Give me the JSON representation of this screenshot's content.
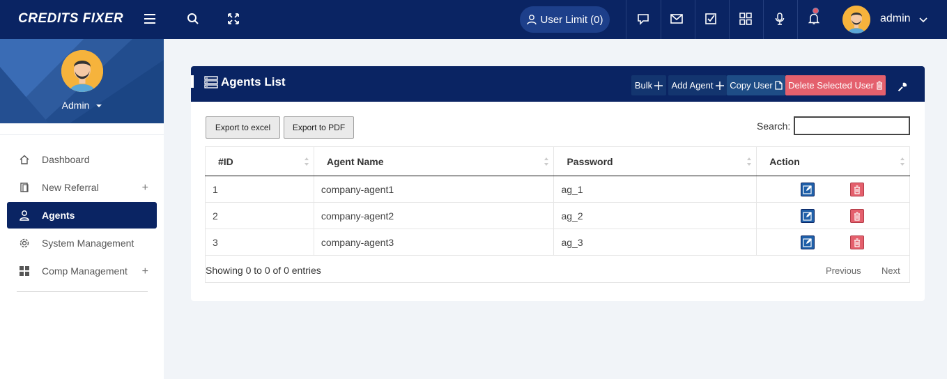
{
  "brand": {
    "logo_text": "CREDITS FIXER"
  },
  "topbar": {
    "user_limit_label": "User Limit (0)",
    "username": "admin",
    "icons": [
      "menu-icon",
      "search-icon",
      "fullscreen-icon",
      "chat-icon",
      "mail-icon",
      "task-check-icon",
      "apps-grid-icon",
      "microphone-icon",
      "bell-icon"
    ]
  },
  "sidebar": {
    "profile_name": "Admin",
    "items": [
      {
        "label": "Dashboard",
        "icon": "home-icon",
        "active": false,
        "expandable": false
      },
      {
        "label": "New Referral",
        "icon": "referral-icon",
        "active": false,
        "expandable": true
      },
      {
        "label": "Agents",
        "icon": "user-icon",
        "active": true,
        "expandable": false
      },
      {
        "label": "System Management",
        "icon": "gear-icon",
        "active": false,
        "expandable": false
      },
      {
        "label": "Comp Management",
        "icon": "grid-icon",
        "active": false,
        "expandable": true
      }
    ],
    "plus_symbol": "+"
  },
  "card": {
    "title": "Agents List",
    "buttons": {
      "bulk": "Bulk",
      "add_agent": "Add Agent",
      "copy_user": "Copy User",
      "delete_selected": "Delete Selected User"
    },
    "export_excel": "Export to excel",
    "export_pdf": "Export to PDF",
    "search_label": "Search:",
    "search_value": ""
  },
  "table": {
    "columns": [
      "#ID",
      "Agent Name",
      "Password",
      "Action"
    ],
    "rows": [
      {
        "id": "1",
        "name": "company-agent1",
        "password": "ag_1"
      },
      {
        "id": "2",
        "name": "company-agent2",
        "password": "ag_2"
      },
      {
        "id": "3",
        "name": "company-agent3",
        "password": "ag_3"
      }
    ]
  },
  "footer": {
    "info": "Showing 0 to 0 of 0 entries",
    "previous": "Previous",
    "next": "Next"
  },
  "colors": {
    "navy": "#0a2463",
    "danger": "#e4606d",
    "avatar": "#f6b33c"
  }
}
